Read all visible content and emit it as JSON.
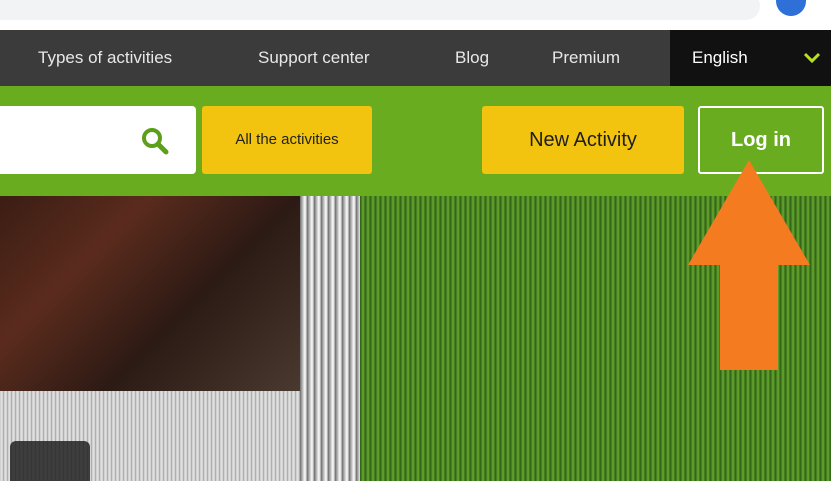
{
  "topnav": {
    "items": [
      {
        "label": "Types of activities"
      },
      {
        "label": "Support center"
      },
      {
        "label": "Blog"
      },
      {
        "label": "Premium"
      }
    ],
    "language": {
      "label": "English",
      "icon": "chevron-down-icon",
      "chevron_color": "#b6e020"
    }
  },
  "header": {
    "search": {
      "value": "",
      "icon": "search-icon",
      "icon_color": "#5d9e1b"
    },
    "all_activities_label": "All the activities",
    "new_activity_label": "New Activity",
    "login_label": "Log in"
  },
  "colors": {
    "nav_dark": "#3b3b3b",
    "brand_green": "#6aac1f",
    "button_yellow": "#f2c410",
    "arrow_orange": "#f47b20"
  },
  "annotation": {
    "icon": "up-arrow-icon",
    "points_to": "Log in"
  }
}
